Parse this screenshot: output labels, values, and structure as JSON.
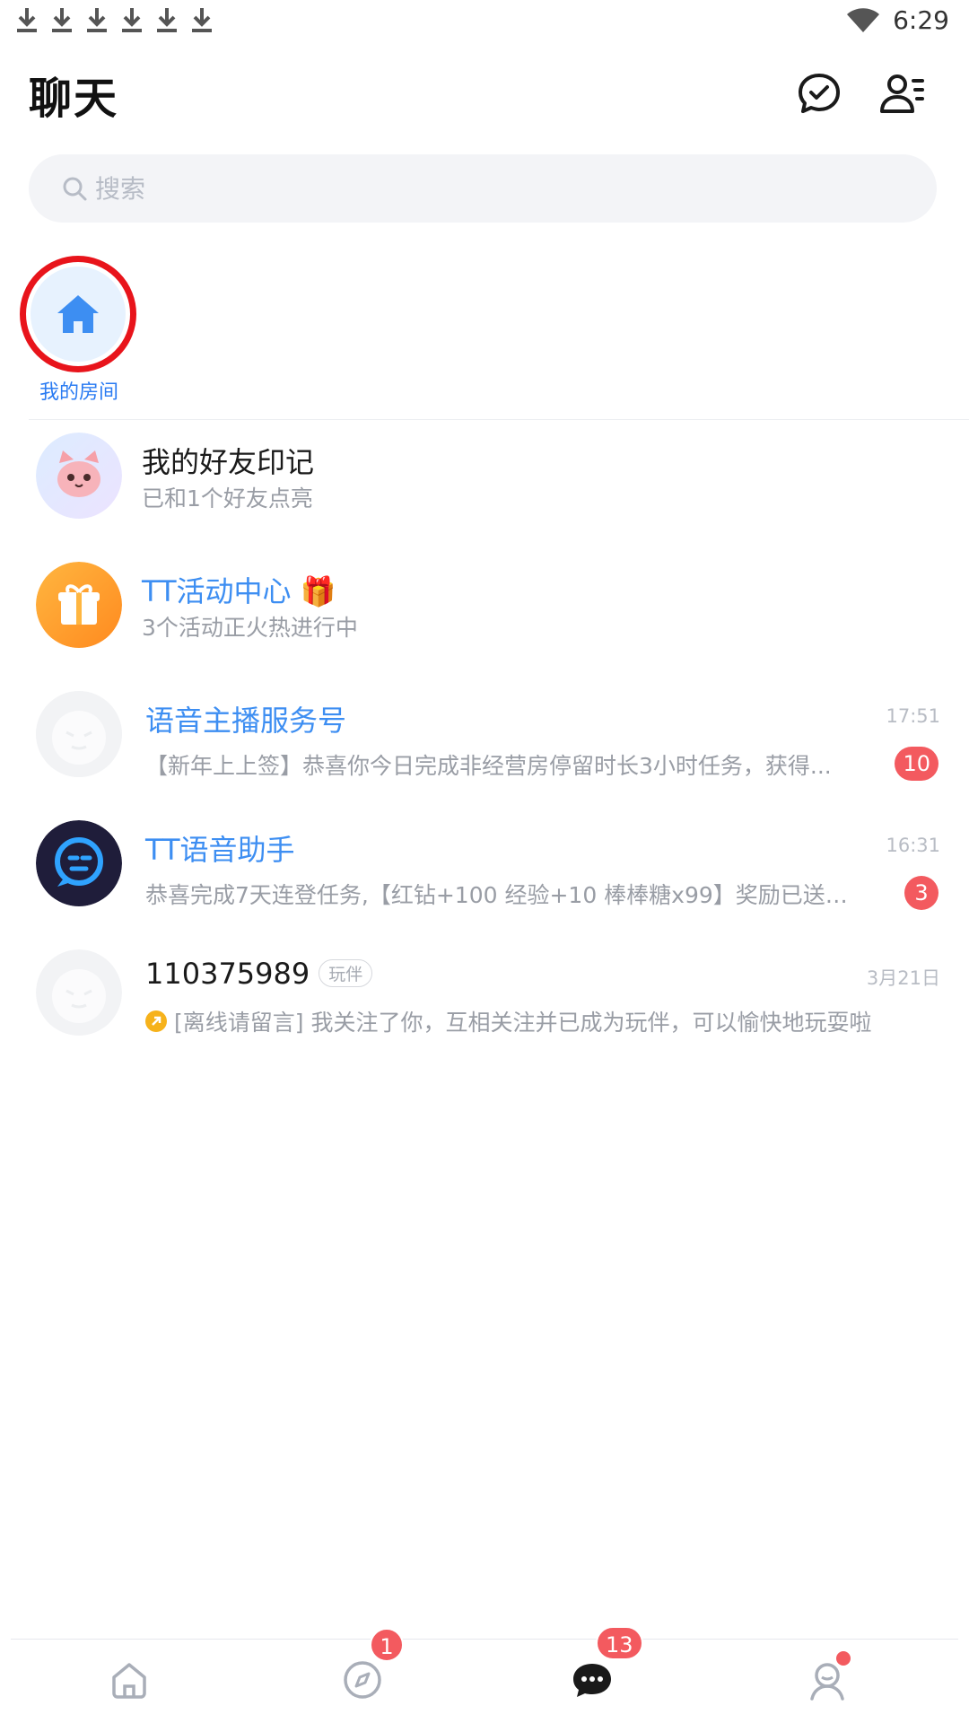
{
  "status_bar": {
    "time": "6:29",
    "download_icons": [
      "download-icon",
      "download-icon",
      "download-icon",
      "download-icon",
      "download-icon",
      "download-icon"
    ]
  },
  "header": {
    "title": "聊天",
    "actions": [
      "chat-check-icon",
      "contacts-list-icon"
    ]
  },
  "search": {
    "placeholder": "搜索"
  },
  "my_room": {
    "label": "我的房间"
  },
  "chats": [
    {
      "title": "我的好友印记",
      "subtitle": "已和1个好友点亮"
    },
    {
      "title": "TT活动中心",
      "emoji": "🎁",
      "subtitle": "3个活动正火热进行中"
    },
    {
      "title": "语音主播服务号",
      "time": "17:51",
      "subtitle": "【新年上上签】恭喜你今日完成非经营房停留时长3小时任务，获得...",
      "badge": "10"
    },
    {
      "title": "TT语音助手",
      "time": "16:31",
      "subtitle": "恭喜完成7天连登任务,【红钻+100 经验+10 棒棒糖x99】奖励已送达...",
      "badge": "3"
    },
    {
      "title": "110375989",
      "tag": "玩伴",
      "time": "3月21日",
      "subtitle": "[离线请留言] 我关注了你，互相关注并已成为玩伴，可以愉快地玩耍啦"
    }
  ],
  "bottom_nav": {
    "items": [
      "home-icon",
      "discover-compass-icon",
      "chat-icon",
      "profile-icon"
    ],
    "discover_badge": "1",
    "chat_badge": "13"
  },
  "colors": {
    "accent_blue": "#3d8ef2",
    "badge_red": "#f35a5f",
    "highlight_red": "#e8141b"
  }
}
